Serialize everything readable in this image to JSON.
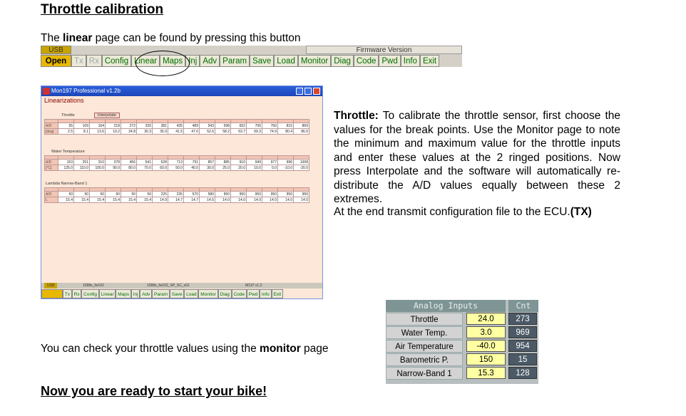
{
  "doc": {
    "title": "Throttle calibration",
    "linear_text": {
      "pre": "The ",
      "bold": "linear",
      "post": " page can be found by pressing this button"
    },
    "throttle_para": {
      "bold": "Throttle:",
      "text": " To calibrate the throttle sensor, first choose the values for the break points. Use the Monitor page to note the minimum and maximum value for the throttle inputs and enter these values at the 2 ringed positions. Now press Interpolate and the software will automatically re-distribute the A/D values equally between these 2 extremes."
    },
    "transmit_para": {
      "text": "At the end transmit configuration file to the ECU.",
      "bold": "(TX)"
    },
    "monitor_text": {
      "pre": "You can check your throttle values using the ",
      "bold": "monitor",
      "post": " page"
    },
    "ready": "Now you are ready to start your bike!"
  },
  "toolbar": {
    "usb": "USB",
    "firmware": "Firmware Version",
    "buttons": [
      "Open",
      "Tx",
      "Rx",
      "Config",
      "Linear",
      "Maps",
      "Inj",
      "Adv",
      "Param",
      "Save",
      "Load",
      "Monitor",
      "Diag",
      "Code",
      "Pwd",
      "Info",
      "Exit"
    ]
  },
  "window": {
    "title": "Mon197 Professional v1.2b",
    "heading": "Linearizations",
    "throttle": {
      "label": "Throttle",
      "button": "Interpolate",
      "rows": [
        {
          "label": "A/D",
          "values": [
            "55",
            "109",
            "164",
            "218",
            "272",
            "326",
            "381",
            "435",
            "489",
            "543",
            "598",
            "652",
            "706",
            "760",
            "815",
            "869"
          ]
        },
        {
          "label": "[deg]",
          "values": [
            "2.5",
            "8.1",
            "13.6",
            "19.2",
            "24.8",
            "30.3",
            "35.9",
            "41.5",
            "47.0",
            "52.6",
            "58.2",
            "63.7",
            "69.3",
            "74.9",
            "80.4",
            "86.0"
          ]
        }
      ]
    },
    "water": {
      "label": "Water Temperature",
      "rows": [
        {
          "label": "A/D",
          "values": [
            "153",
            "251",
            "310",
            "378",
            "456",
            "541",
            "628",
            "713",
            "791",
            "857",
            "885",
            "910",
            "949",
            "977",
            "996",
            "1008"
          ]
        },
        {
          "label": "[°C]",
          "values": [
            "125.0",
            "110.0",
            "100.0",
            "90.0",
            "80.0",
            "70.0",
            "60.0",
            "50.0",
            "40.0",
            "30.0",
            "25.0",
            "20.0",
            "10.0",
            "0.0",
            "-10.0",
            "-20.0"
          ]
        }
      ]
    },
    "lambda": {
      "label": "Lambda Narrow-Band 1",
      "rows": [
        {
          "label": "A/D",
          "values": [
            "50",
            "50",
            "50",
            "50",
            "50",
            "50",
            "225",
            "235",
            "570",
            "580",
            "950",
            "950",
            "950",
            "950",
            "950",
            "950"
          ]
        },
        {
          "label": "L",
          "values": [
            "15.4",
            "15.4",
            "15.4",
            "15.4",
            "15.4",
            "15.4",
            "14.9",
            "14.7",
            "14.7",
            "14.5",
            "14.0",
            "14.0",
            "14.0",
            "14.0",
            "14.0",
            "14.0"
          ]
        }
      ]
    },
    "status": {
      "usb": "USB",
      "file1": "1098s_fw102",
      "file2": "1098s_fw102_SP_SC_v01",
      "version": "M197 v1.2"
    },
    "buttons": [
      "Open",
      "Tx",
      "Rx",
      "Config",
      "Linear",
      "Maps",
      "Inj",
      "Adv",
      "Param",
      "Save",
      "Load",
      "Monitor",
      "Diag",
      "Code",
      "Pwd",
      "Info",
      "Exit"
    ]
  },
  "analog": {
    "header": "Analog Inputs",
    "cnt_header": "Cnt",
    "rows": [
      {
        "name": "Throttle",
        "value": "24.0",
        "cnt": "273"
      },
      {
        "name": "Water Temp.",
        "value": "3.0",
        "cnt": "969"
      },
      {
        "name": "Air Temperature",
        "value": "-40.0",
        "cnt": "954"
      },
      {
        "name": "Barometric P.",
        "value": "150",
        "cnt": "15"
      },
      {
        "name": "Narrow-Band 1",
        "value": "15.3",
        "cnt": "128"
      }
    ]
  }
}
